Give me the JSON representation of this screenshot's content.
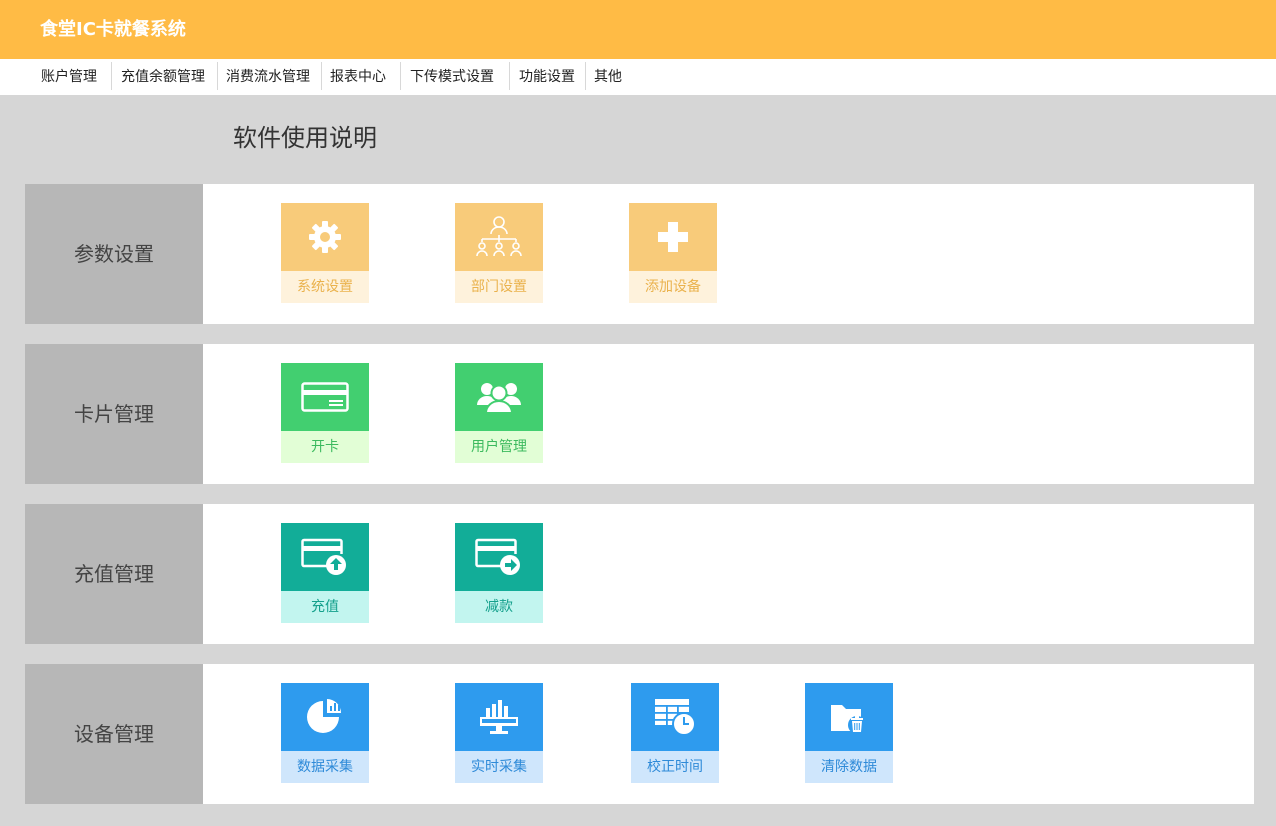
{
  "header": {
    "title": "食堂IC卡就餐系统"
  },
  "menu": {
    "items": [
      "账户管理",
      "充值余额管理",
      "消费流水管理",
      "报表中心",
      "下传模式设置",
      "功能设置",
      "其他"
    ]
  },
  "page": {
    "heading": "软件使用说明"
  },
  "sections": [
    {
      "label": "参数设置",
      "tiles": [
        {
          "label": "系统设置",
          "icon": "gear-icon"
        },
        {
          "label": "部门设置",
          "icon": "org-chart-icon"
        },
        {
          "label": "添加设备",
          "icon": "plus-icon"
        }
      ]
    },
    {
      "label": "卡片管理",
      "tiles": [
        {
          "label": "开卡",
          "icon": "card-icon"
        },
        {
          "label": "用户管理",
          "icon": "users-icon"
        }
      ]
    },
    {
      "label": "充值管理",
      "tiles": [
        {
          "label": "充值",
          "icon": "card-upload-icon"
        },
        {
          "label": "减款",
          "icon": "card-arrow-right-icon"
        }
      ]
    },
    {
      "label": "设备管理",
      "tiles": [
        {
          "label": "数据采集",
          "icon": "pie-chart-icon"
        },
        {
          "label": "实时采集",
          "icon": "monitor-chart-icon"
        },
        {
          "label": "校正时间",
          "icon": "calendar-clock-icon"
        },
        {
          "label": "清除数据",
          "icon": "folder-trash-icon"
        }
      ]
    }
  ],
  "colors": {
    "header": "#ffbb45",
    "orange_tile": "#f8cb7a",
    "green_tile": "#42cf70",
    "teal_tile": "#12ad98",
    "blue_tile": "#2e9bee"
  }
}
